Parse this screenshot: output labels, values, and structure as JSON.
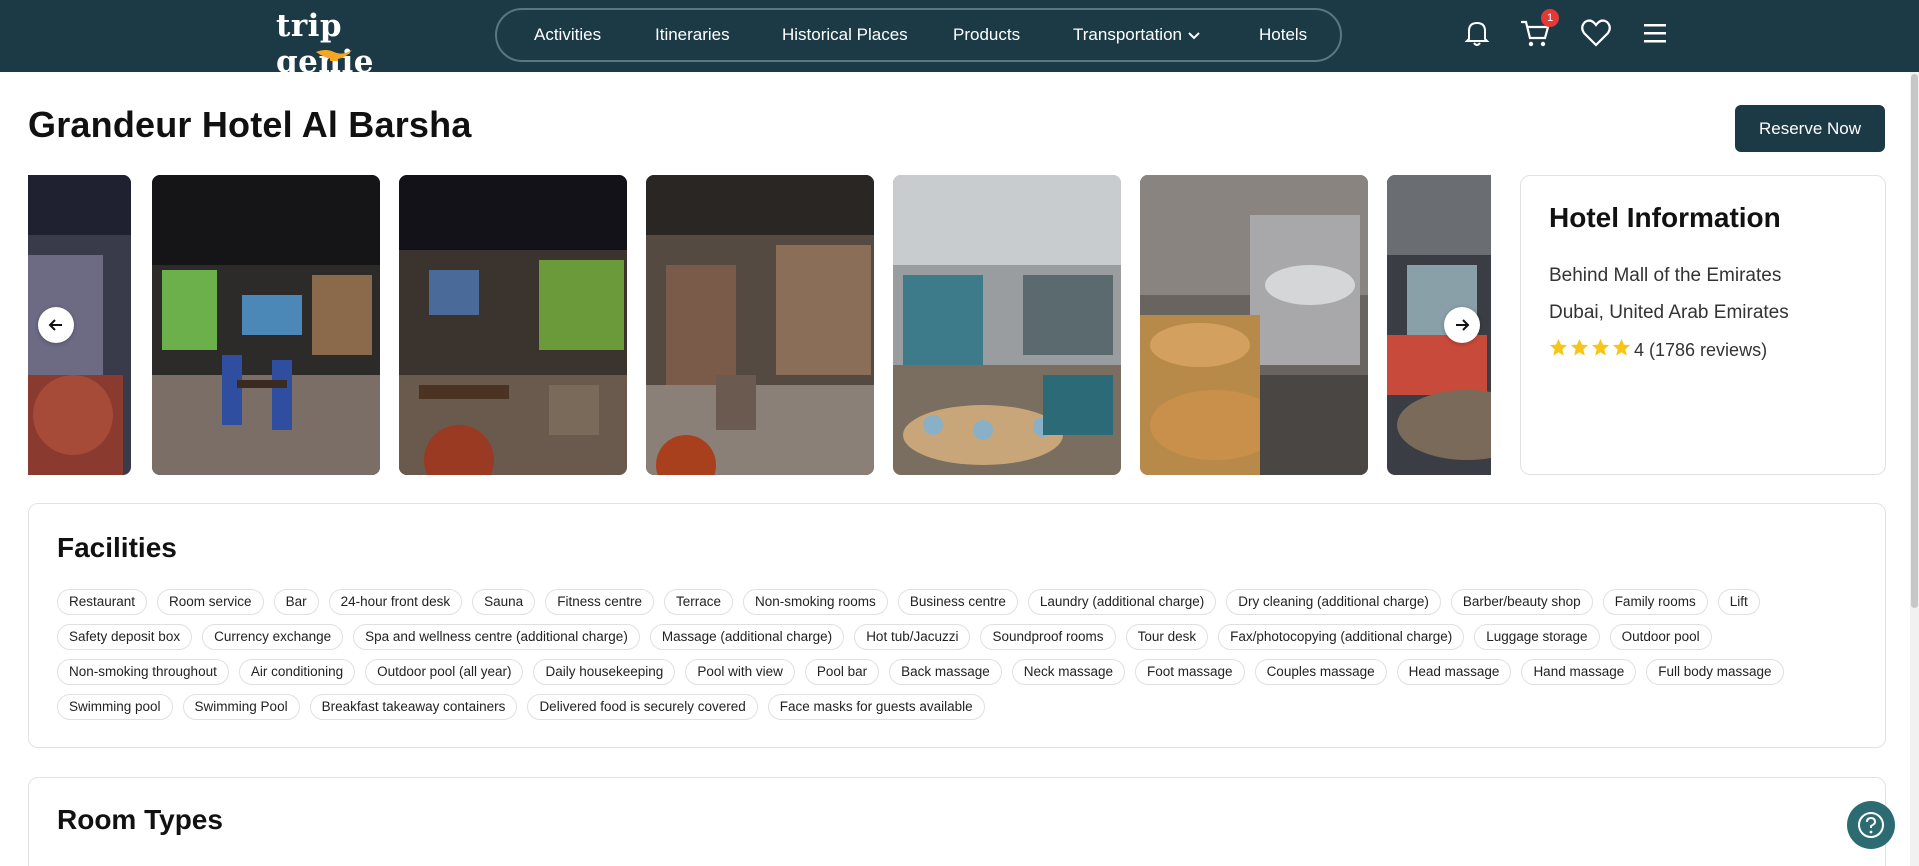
{
  "header": {
    "logo_text": "trip genie",
    "nav": [
      {
        "label": "Activities"
      },
      {
        "label": "Itineraries"
      },
      {
        "label": "Historical Places"
      },
      {
        "label": "Products"
      },
      {
        "label": "Transportation"
      },
      {
        "label": "Hotels"
      }
    ],
    "cart_count": "1",
    "icons": [
      "bell-icon",
      "cart-icon",
      "heart-icon",
      "menu-icon"
    ]
  },
  "hotel": {
    "name": "Grandeur Hotel Al Barsha",
    "reserve_label": "Reserve Now",
    "info_title": "Hotel Information",
    "address_line1": "Behind Mall of the Emirates",
    "address_line2": "Dubai, United Arab Emirates",
    "rating": 4,
    "rating_text": "4 (1786 reviews)"
  },
  "facilities": {
    "title": "Facilities",
    "items": [
      "Restaurant",
      "Room service",
      "Bar",
      "24-hour front desk",
      "Sauna",
      "Fitness centre",
      "Terrace",
      "Non-smoking rooms",
      "Business centre",
      "Laundry (additional charge)",
      "Dry cleaning (additional charge)",
      "Barber/beauty shop",
      "Family rooms",
      "Lift",
      "Safety deposit box",
      "Currency exchange",
      "Spa and wellness centre (additional charge)",
      "Massage (additional charge)",
      "Hot tub/Jacuzzi",
      "Soundproof rooms",
      "Tour desk",
      "Fax/photocopying (additional charge)",
      "Luggage storage",
      "Outdoor pool",
      "Non-smoking throughout",
      "Air conditioning",
      "Outdoor pool (all year)",
      "Daily housekeeping",
      "Pool with view",
      "Pool bar",
      "Back massage",
      "Neck massage",
      "Foot massage",
      "Couples massage",
      "Head massage",
      "Hand massage",
      "Full body massage",
      "Swimming pool",
      "Swimming Pool",
      "Breakfast takeaway containers",
      "Delivered food is securely covered",
      "Face masks for guests available"
    ]
  },
  "room_types": {
    "title": "Room Types"
  },
  "colors": {
    "brand": "#1b3a46",
    "accent": "#f5a623",
    "star": "#f5c518",
    "badge": "#e53935",
    "help": "#2d6b73"
  }
}
